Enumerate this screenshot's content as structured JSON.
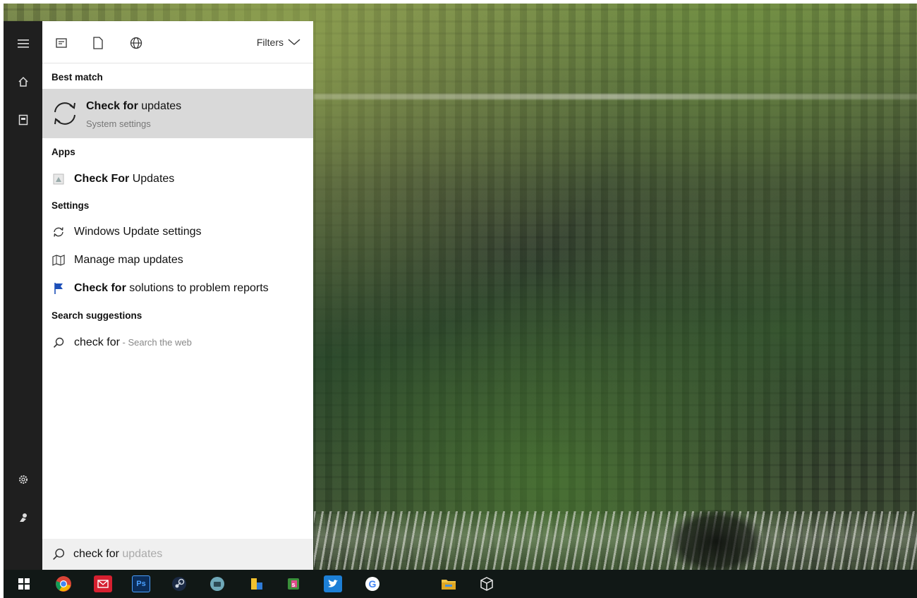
{
  "panel": {
    "filters_label": "Filters",
    "sections": {
      "best_match": "Best match",
      "apps": "Apps",
      "settings": "Settings",
      "suggestions": "Search suggestions"
    },
    "best_match": {
      "title_bold": "Check for",
      "title_rest": " updates",
      "subtitle": "System settings"
    },
    "apps": [
      {
        "bold": "Check For",
        "rest": " Updates",
        "icon": "app-icon"
      }
    ],
    "settings": [
      {
        "bold": "",
        "rest": "Windows Update settings",
        "icon": "refresh-icon"
      },
      {
        "bold": "",
        "rest": "Manage map updates",
        "icon": "map-icon"
      },
      {
        "bold": "Check for",
        "rest": " solutions to problem reports",
        "icon": "flag-icon"
      }
    ],
    "suggestion": {
      "query": "check for",
      "hint": " - Search the web"
    },
    "search_box": {
      "typed": "check for ",
      "ghost": "updates"
    }
  },
  "colors": {
    "rail_bg": "#1f1f1f",
    "best_match_bg": "#d9d9d9",
    "search_box_bg": "#f0f0f0",
    "taskbar_bg": "#111816"
  },
  "taskbar_icons": [
    "windows-start-icon",
    "chrome-icon",
    "mail-icon",
    "photoshop-icon",
    "steam-icon",
    "app-round-icon",
    "explorer-app-icon",
    "stack-app-icon",
    "twitter-icon",
    "google-icon",
    "file-explorer-icon",
    "cube-app-icon"
  ]
}
